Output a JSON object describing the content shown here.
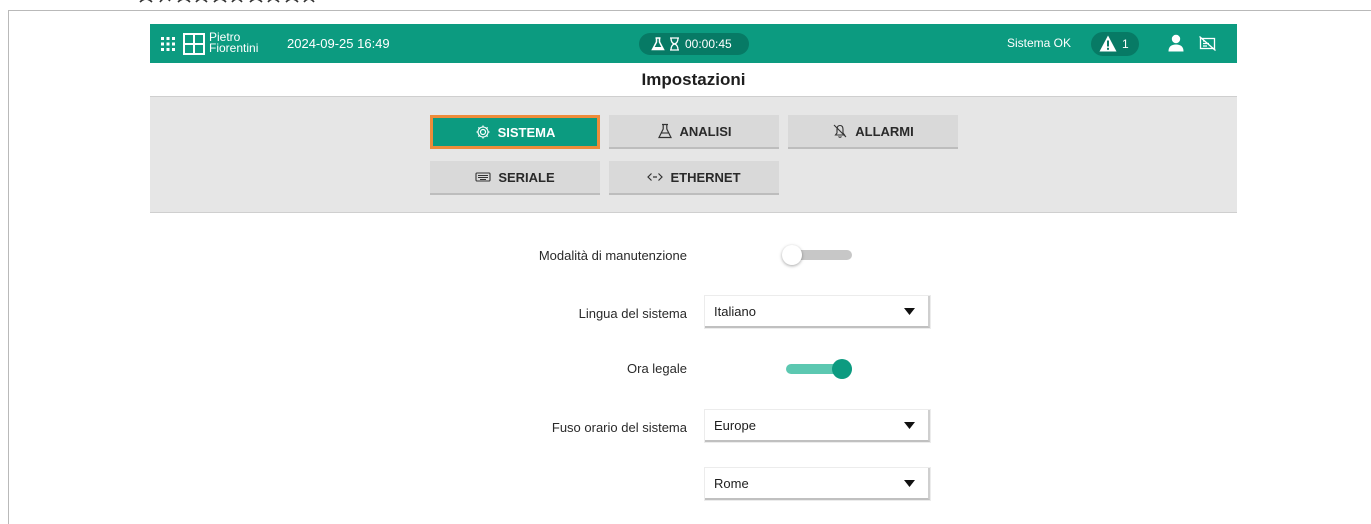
{
  "topbar": {
    "brand_line1": "Pietro",
    "brand_line2": "Fiorentini",
    "datetime": "2024-09-25 16:49",
    "timer": "00:00:45",
    "status": "Sistema OK",
    "alarm_count": "1",
    "icons": [
      "grid-icon",
      "logo-icon",
      "flask-icon",
      "hourglass-icon",
      "warning-icon",
      "user-icon",
      "network-disconnected-icon"
    ]
  },
  "page": {
    "title": "Impostazioni"
  },
  "tabs": [
    {
      "label": "SISTEMA",
      "icon": "gear-icon",
      "active": true
    },
    {
      "label": "ANALISI",
      "icon": "flask-icon",
      "active": false
    },
    {
      "label": "ALLARMI",
      "icon": "bell-off-icon",
      "active": false
    },
    {
      "label": "SERIALE",
      "icon": "keyboard-icon",
      "active": false
    },
    {
      "label": "ETHERNET",
      "icon": "code-arrows-icon",
      "active": false
    }
  ],
  "settings": {
    "maintenance_label": "Modalità di manutenzione",
    "maintenance_on": false,
    "language_label": "Lingua del sistema",
    "language_value": "Italiano",
    "dst_label": "Ora legale",
    "dst_on": true,
    "timezone_label": "Fuso orario del sistema",
    "timezone_region": "Europe",
    "timezone_city": "Rome"
  },
  "colors": {
    "primary": "#0c9b80",
    "primary_dark": "#077a65",
    "active_outline": "#ee8c3a",
    "toggle_track_on": "#5cc8b1"
  }
}
